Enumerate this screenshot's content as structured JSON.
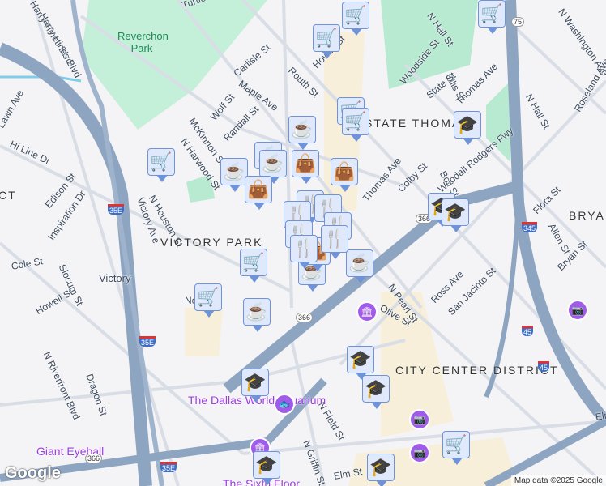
{
  "map": {
    "areas": [
      "VICTORY PARK",
      "STATE THOMAS",
      "CITY CENTER DISTRICT",
      "BRYAN",
      "CT"
    ],
    "park": "Reverchon Park",
    "pois": [
      "The Dallas World Aquarium",
      "Giant Eyeball",
      "The Sixth Floor"
    ],
    "transit": "Victory",
    "streets": [
      "Harry Hines Blvd",
      "Harry Hines Blvd",
      "Maple Ave",
      "Turtle Creek",
      "Carlisle St",
      "Wolf St",
      "Randall St",
      "McKinnon St",
      "N Harwood St",
      "Routh St",
      "Howell St",
      "N Hall St",
      "Woodside St",
      "Ellis St",
      "State St",
      "Thomas Ave",
      "N Hall St",
      "N Washington Ave",
      "Colby St",
      "Boll St",
      "Woodall Rodgers Fwy",
      "Flora St",
      "Allen St",
      "Roseland Ave",
      "Thomas Ave",
      "N Houston St",
      "Victory Ave",
      "Edison St",
      "Inspiration Dr",
      "Hi Line Dr",
      "Lawn Ave",
      "Cole St",
      "Slocum St",
      "Howell St",
      "N Riverfront Blvd",
      "Dragon St",
      "N Pearl St",
      "Ross Ave",
      "San Jacinto St",
      "Olive St",
      "Bryan St",
      "N Field St",
      "N Griffin St",
      "Elm St",
      "No",
      "Elm"
    ],
    "shields": {
      "i35e": "35E",
      "i345": "345",
      "i45": "45",
      "us75": "75",
      "sh366": "366"
    }
  },
  "markers": {
    "types": [
      "grocery-icon",
      "cafe-icon",
      "shopping-bag-icon",
      "restaurant-icon",
      "education-icon"
    ]
  },
  "footer": {
    "logo": "Google",
    "attribution": "Map data ©2025 Google"
  }
}
